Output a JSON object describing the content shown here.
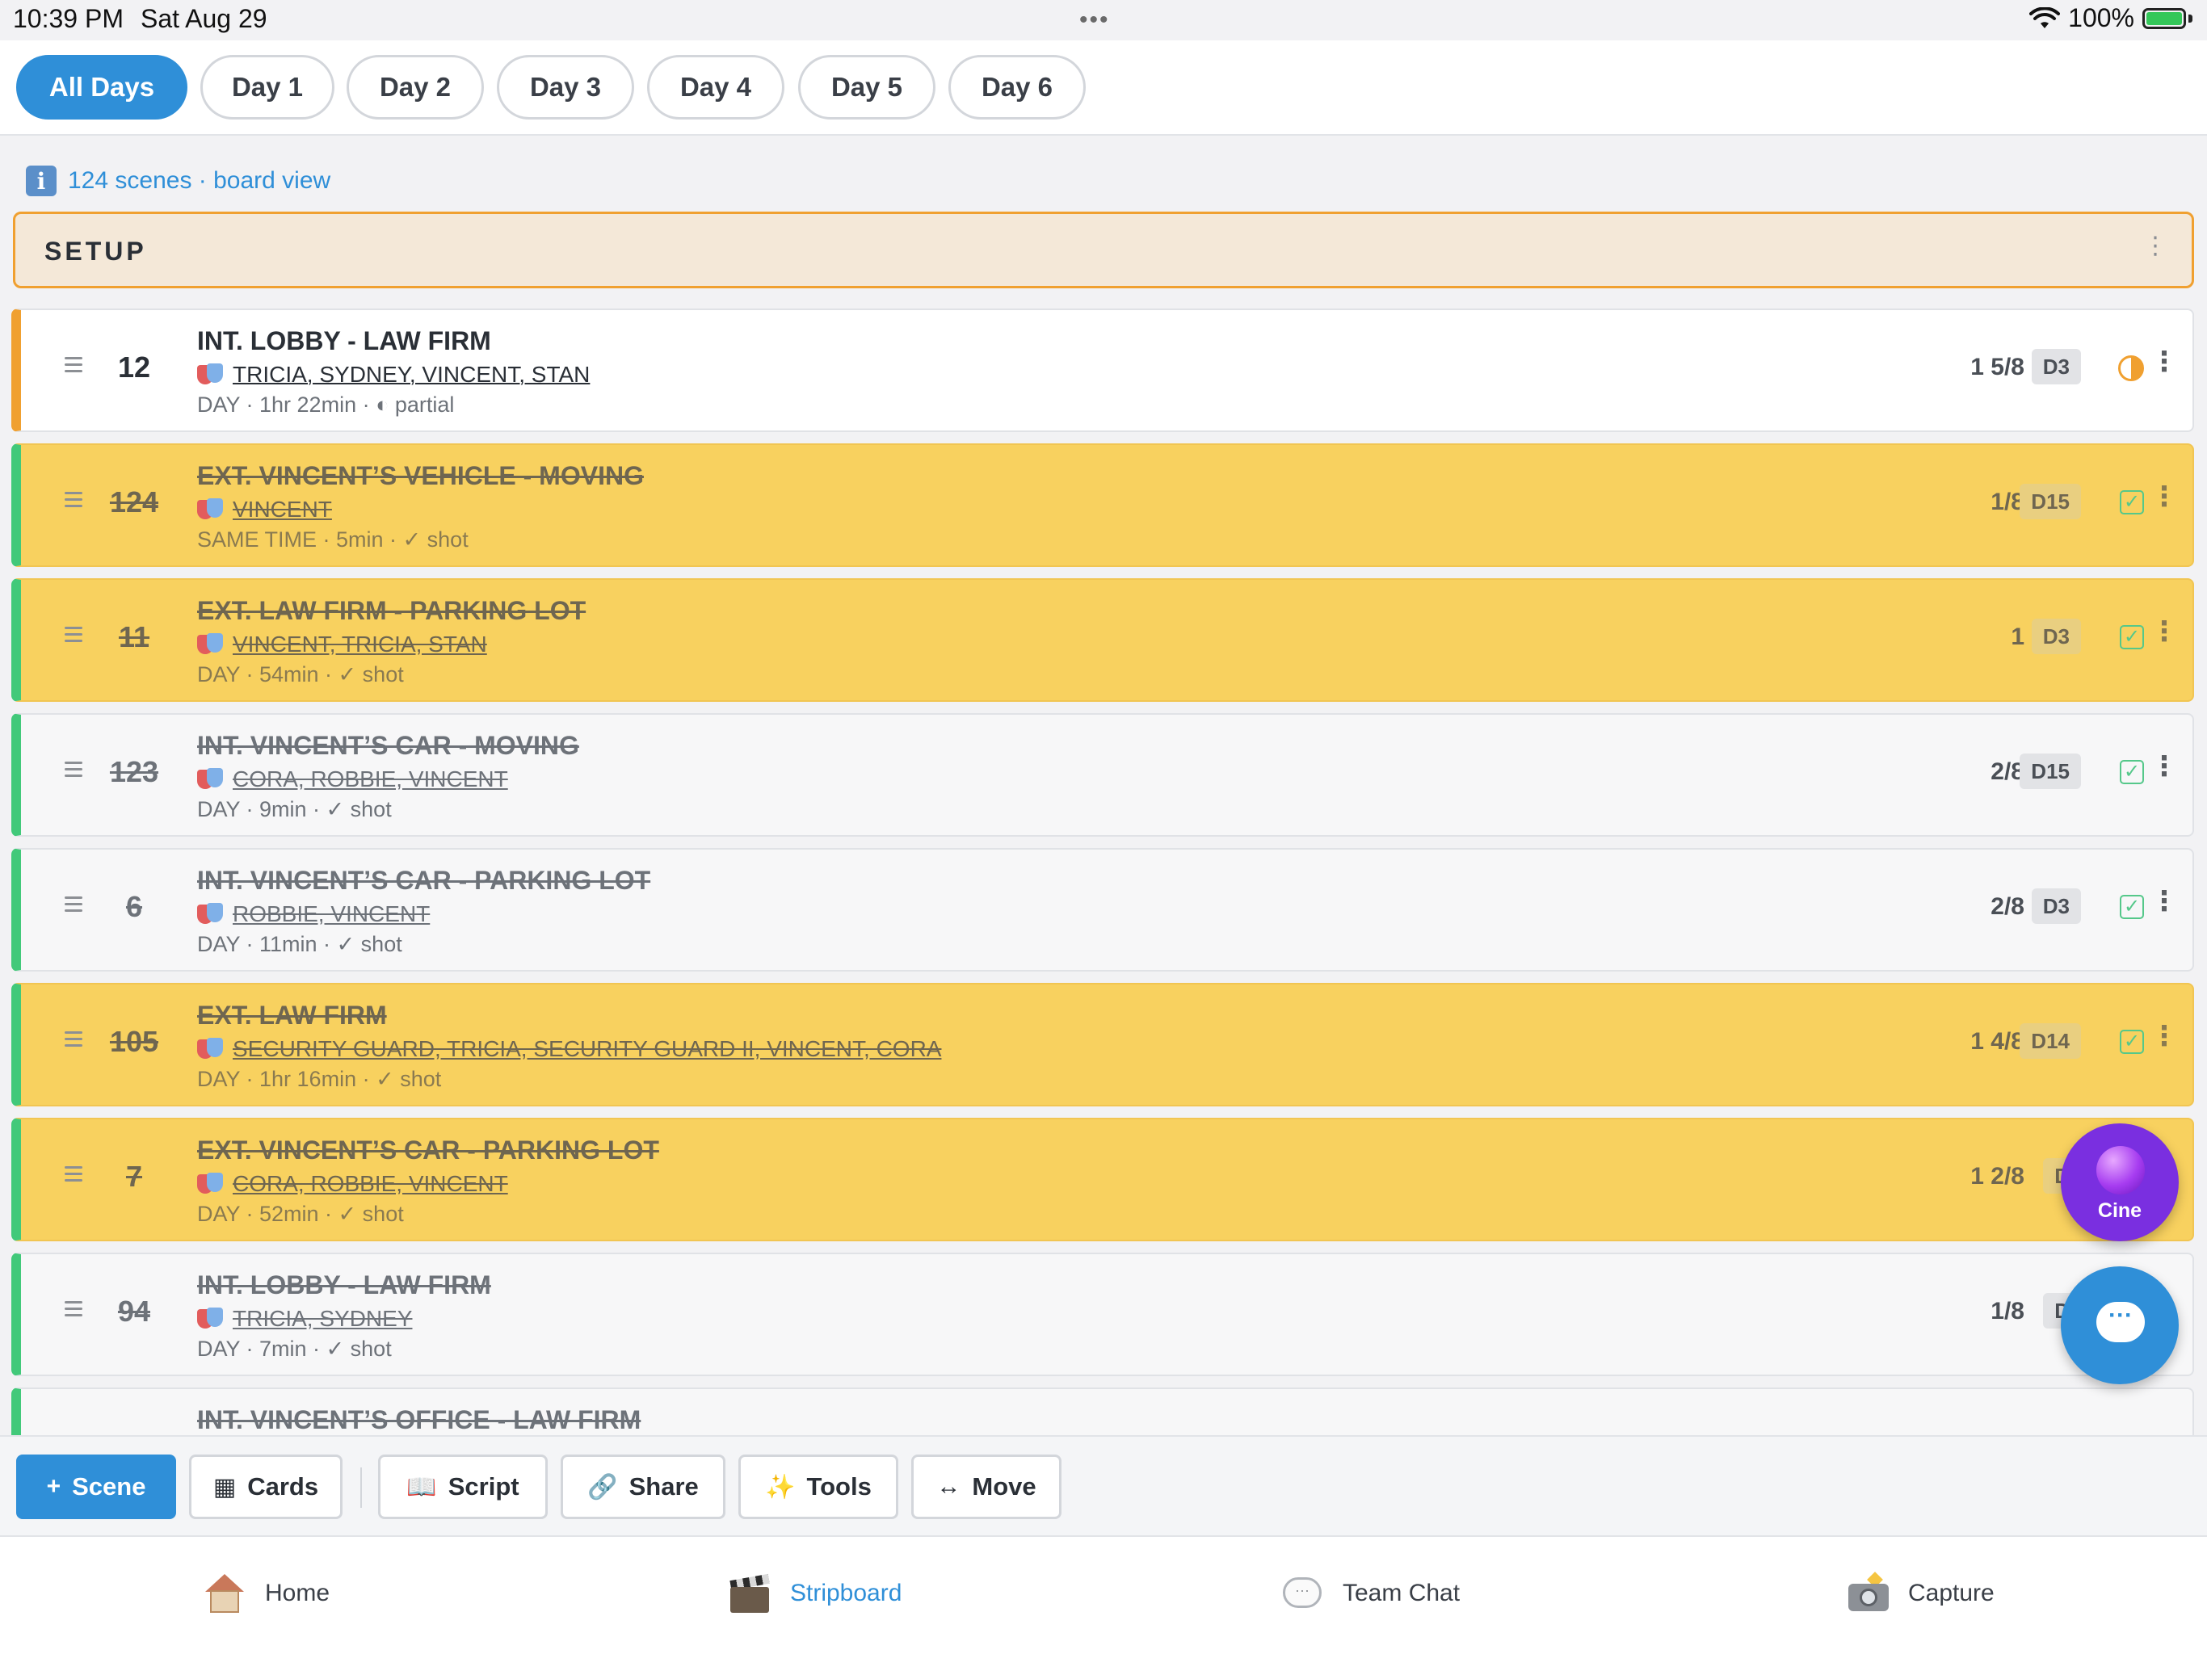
{
  "status": {
    "time": "10:39 PM",
    "date": "Sat Aug 29",
    "battery": "100%",
    "more": "•••"
  },
  "day_tabs": [
    {
      "label": "All Days",
      "active": true
    },
    {
      "label": "Day 1",
      "active": false
    },
    {
      "label": "Day 2",
      "active": false
    },
    {
      "label": "Day 3",
      "active": false
    },
    {
      "label": "Day 4",
      "active": false
    },
    {
      "label": "Day 5",
      "active": false
    },
    {
      "label": "Day 6",
      "active": false
    }
  ],
  "info": {
    "icon": "i",
    "text": "124 scenes · board view"
  },
  "setup": {
    "label": "SETUP",
    "kebab": "⋮"
  },
  "scenes": [
    {
      "number": "12",
      "title": "INT. LOBBY - LAW FIRM",
      "cast": "TRICIA, SYDNEY, VINCENT, STAN",
      "meta": "DAY  ·  1hr 22min  ·  ◐ partial",
      "pages": "1 5/8",
      "day": "D3",
      "status": "partial",
      "color": "white",
      "kebab": "⋮"
    },
    {
      "number": "124",
      "title": "EXT. VINCENT’S VEHICLE - MOVING",
      "cast": "VINCENT",
      "meta": "SAME TIME  ·  5min  ·  ✓ shot",
      "pages": "1/8",
      "day": "D15",
      "status": "shot",
      "color": "yellow",
      "check": "✓",
      "kebab": "⋮"
    },
    {
      "number": "11",
      "title": "EXT. LAW FIRM - PARKING LOT",
      "cast": "VINCENT, TRICIA, STAN",
      "meta": "DAY  ·  54min  ·  ✓ shot",
      "pages": "1",
      "day": "D3",
      "status": "shot",
      "color": "yellow",
      "check": "✓",
      "kebab": "⋮"
    },
    {
      "number": "123",
      "title": "INT. VINCENT’S CAR - MOVING",
      "cast": "CORA, ROBBIE, VINCENT",
      "meta": "DAY  ·  9min  ·  ✓ shot",
      "pages": "2/8",
      "day": "D15",
      "status": "shot",
      "color": "white",
      "check": "✓",
      "kebab": "⋮"
    },
    {
      "number": "6",
      "title": "INT. VINCENT’S CAR - PARKING LOT",
      "cast": "ROBBIE, VINCENT",
      "meta": "DAY  ·  11min  ·  ✓ shot",
      "pages": "2/8",
      "day": "D3",
      "status": "shot",
      "color": "white",
      "check": "✓",
      "kebab": "⋮"
    },
    {
      "number": "105",
      "title": "EXT. LAW FIRM",
      "cast": "SECURITY GUARD, TRICIA, SECURITY GUARD II, VINCENT, CORA",
      "meta": "DAY  ·  1hr 16min  ·  ✓ shot",
      "pages": "1 4/8",
      "day": "D14",
      "status": "shot",
      "color": "yellow",
      "check": "✓",
      "kebab": "⋮"
    },
    {
      "number": "7",
      "title": "EXT. VINCENT’S CAR - PARKING LOT",
      "cast": "CORA, ROBBIE, VINCENT",
      "meta": "DAY  ·  52min  ·  ✓ shot",
      "pages": "1 2/8",
      "day": "D",
      "status": "shot",
      "color": "yellow",
      "check": "✓",
      "kebab": "⋮"
    },
    {
      "number": "94",
      "title": "INT. LOBBY - LAW FIRM",
      "cast": "TRICIA, SYDNEY",
      "meta": "DAY  ·  7min  ·  ✓ shot",
      "pages": "1/8",
      "day": "D",
      "status": "shot",
      "color": "white",
      "check": "✓",
      "kebab": "⋮"
    },
    {
      "number": "",
      "title": "INT. VINCENT’S OFFICE - LAW FIRM",
      "cast": "",
      "meta": "",
      "pages": "",
      "day": "",
      "status": "shot",
      "color": "white",
      "check": "",
      "kebab": ""
    }
  ],
  "fab": {
    "cine_label": "Cine",
    "chat_glyph": "···"
  },
  "toolbar": {
    "scene": {
      "icon": "+",
      "label": "Scene"
    },
    "cards": {
      "icon": "▦",
      "label": "Cards"
    },
    "script": {
      "icon": "📖",
      "label": "Script"
    },
    "share": {
      "icon": "🔗",
      "label": "Share"
    },
    "tools": {
      "icon": "✨",
      "label": "Tools"
    },
    "move": {
      "icon": "↔",
      "label": "Move"
    }
  },
  "tabbar": {
    "home": "Home",
    "stripboard": "Stripboard",
    "team_chat": "Team Chat",
    "capture": "Capture",
    "speech_glyph": "···"
  },
  "colors": {
    "accent": "#2f8fd8",
    "strip_yellow": "#f8d15f",
    "shot_green": "#42c97a",
    "partial_orange": "#f0a030",
    "cine_purple": "#7a2fe0"
  }
}
